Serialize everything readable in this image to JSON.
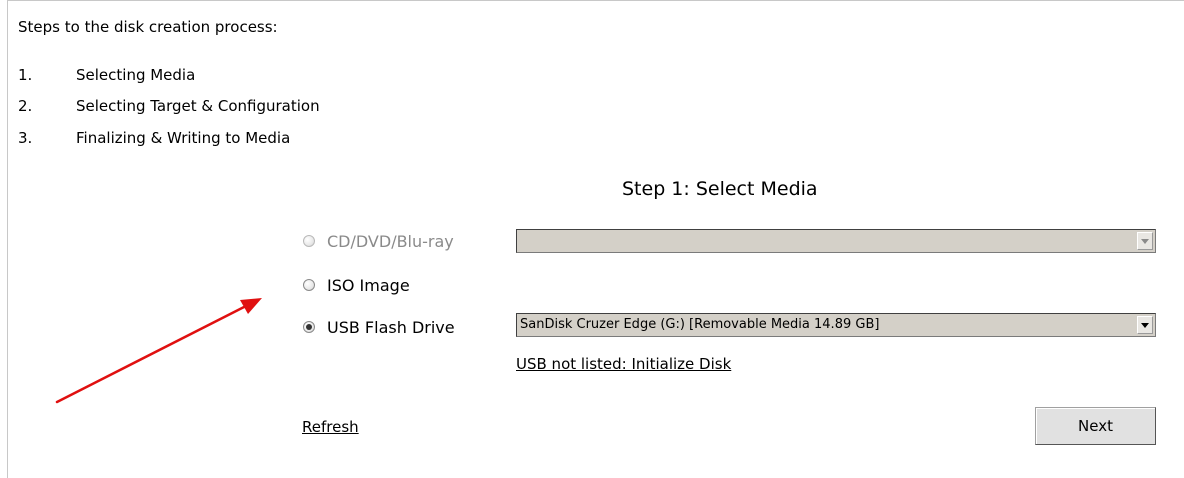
{
  "intro": "Steps to the disk creation process:",
  "steps": [
    {
      "num": "1.",
      "text": "Selecting Media"
    },
    {
      "num": "2.",
      "text": "Selecting Target & Configuration"
    },
    {
      "num": "3.",
      "text": "Finalizing & Writing to Media"
    }
  ],
  "heading": "Step 1: Select Media",
  "media_options": [
    {
      "label": "CD/DVD/Blu-ray",
      "selected": false,
      "enabled": false,
      "dropdown_value": ""
    },
    {
      "label": "ISO Image",
      "selected": false,
      "enabled": true
    },
    {
      "label": "USB Flash Drive",
      "selected": true,
      "enabled": true,
      "dropdown_value": "SanDisk Cruzer Edge (G:) [Removable Media 14.89 GB]"
    }
  ],
  "usb_link": "USB not listed: Initialize Disk",
  "refresh_label": "Refresh",
  "next_label": "Next",
  "colors": {
    "annotation_arrow": "#e01010"
  }
}
